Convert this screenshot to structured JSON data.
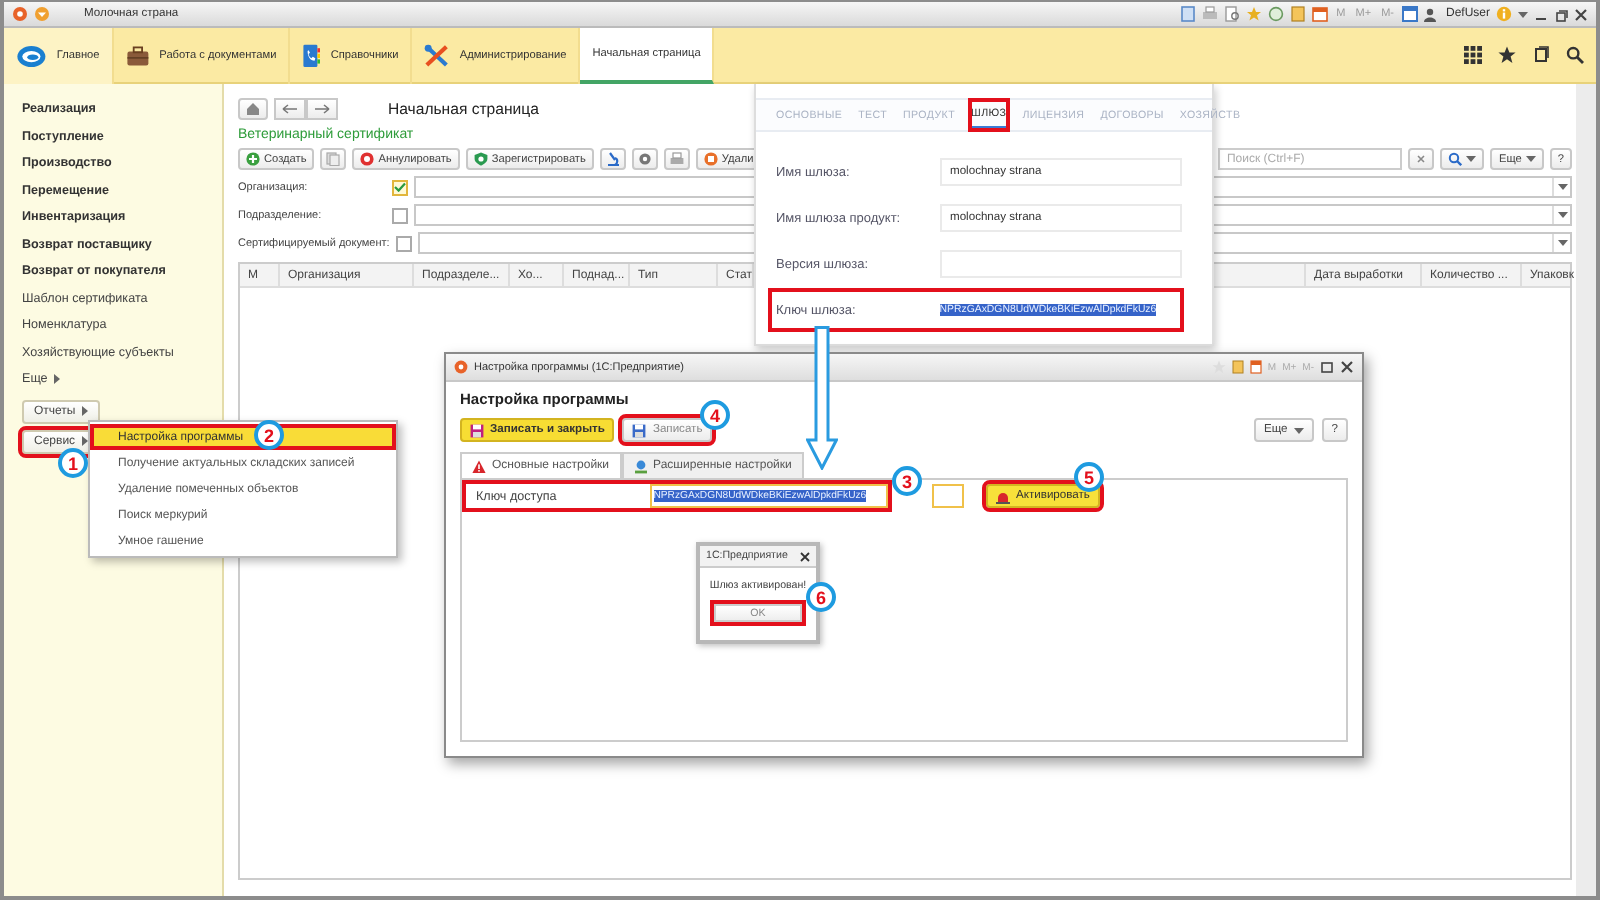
{
  "window": {
    "title": "Молочная страна",
    "memory_buttons": [
      "M",
      "M+",
      "M-"
    ],
    "user": "DefUser"
  },
  "sections": [
    {
      "label": "Главное",
      "selected": false
    },
    {
      "label": "Работа с документами",
      "selected": false
    },
    {
      "label": "Справочники",
      "selected": false
    },
    {
      "label": "Администрирование",
      "selected": false
    },
    {
      "label": "Начальная страница",
      "selected": true
    }
  ],
  "sidebar": {
    "items": [
      {
        "label": "Реализация",
        "kind": "bold"
      },
      {
        "label": "Поступление",
        "kind": "bold"
      },
      {
        "label": "Производство",
        "kind": "bold"
      },
      {
        "label": "Перемещение",
        "kind": "bold"
      },
      {
        "label": "Инвентаризация",
        "kind": "bold"
      },
      {
        "label": "Возврат поставщику",
        "kind": "bold"
      },
      {
        "label": "Возврат от покупателя",
        "kind": "bold"
      },
      {
        "label": "Шаблон сертификата",
        "kind": "plain"
      },
      {
        "label": "Номенклатура",
        "kind": "plain"
      },
      {
        "label": "Хозяйствующие субъекты",
        "kind": "plain"
      },
      {
        "label": "Еще",
        "kind": "more"
      }
    ],
    "buttons": [
      {
        "label": "Отчеты",
        "framed": false
      },
      {
        "label": "Сервис",
        "framed": true
      }
    ]
  },
  "service_menu": {
    "items": [
      {
        "label": "Настройка программы",
        "selected": true,
        "framed": true
      },
      {
        "label": "Получение актуальных складских записей",
        "selected": false,
        "framed": false
      },
      {
        "label": "Удаление помеченных объектов",
        "selected": false,
        "framed": false
      },
      {
        "label": "Поиск меркурий",
        "selected": false,
        "framed": false
      },
      {
        "label": "Умное гашение",
        "selected": false,
        "framed": false
      }
    ]
  },
  "form": {
    "title": "Начальная страница",
    "list_title": "Ветеринарный сертификат",
    "toolbar": [
      "Создать",
      "Аннулировать",
      "Зарегистрировать",
      "Удали"
    ],
    "search": {
      "placeholder": "Поиск (Ctrl+F)"
    },
    "more": "Еще",
    "help": "?",
    "filters": [
      {
        "label": "Организация:",
        "checked": true
      },
      {
        "label": "Подразделение:",
        "checked": false
      },
      {
        "label": "Сертифицируемый документ:",
        "checked": false
      }
    ],
    "table": {
      "columns": [
        "М",
        "Организация",
        "Подразделе...",
        "Хо...",
        "Поднад...",
        "Тип",
        "Стат",
        "Дата выработки",
        "Количество ...",
        "Упаковк"
      ]
    }
  },
  "gateway_panel": {
    "tabs": [
      {
        "label": "ОСНОВНЫЕ",
        "selected": false,
        "framed": false
      },
      {
        "label": "ТЕСТ",
        "selected": false,
        "framed": false
      },
      {
        "label": "ПРОДУКТ",
        "selected": false,
        "framed": false
      },
      {
        "label": "ШЛЮЗ",
        "selected": true,
        "framed": true
      },
      {
        "label": "ЛИЦЕНЗИЯ",
        "selected": false,
        "framed": false
      },
      {
        "label": "ДОГОВОРЫ",
        "selected": false,
        "framed": false
      },
      {
        "label": "ХОЗЯЙСТВ",
        "selected": false,
        "framed": false
      }
    ],
    "fields": [
      {
        "label": "Имя шлюза:",
        "value": "molochnay strana",
        "framed": false
      },
      {
        "label": "Имя шлюза продукт:",
        "value": "molochnay strana",
        "framed": false
      },
      {
        "label": "Версия шлюза:",
        "framed": false
      },
      {
        "label": "Ключ шлюза:",
        "value": "NPRzGAxDGN8UdWDkeBKiEzwAlDpkdFkUz6",
        "framed": true
      }
    ]
  },
  "settings_dialog": {
    "window_title": "Настройка программы (1С:Предприятие)",
    "memory_buttons": [
      "M",
      "M+",
      "M-"
    ],
    "title": "Настройка программы",
    "buttons": [
      {
        "label": "Записать и закрыть",
        "kind": "primary",
        "framed": false
      },
      {
        "label": "Записать",
        "kind": "normal",
        "framed": true
      }
    ],
    "more": "Еще",
    "help": "?",
    "tabs": [
      {
        "label": "Основные настройки",
        "selected": true
      },
      {
        "label": "Расширенные настройки",
        "selected": false
      }
    ],
    "key_field": {
      "label": "Ключ доступа",
      "value": "NPRzGAxDGN8UdWDkeBKiEzwAlDpkdFkUz6",
      "framed": true
    },
    "activate": {
      "label": "Активировать",
      "framed": true
    }
  },
  "message_box": {
    "title": "1С:Предприятие",
    "text": "Шлюз активирован!",
    "button": "OK",
    "framed": true
  },
  "steps": [
    "1",
    "2",
    "3",
    "4",
    "5",
    "6"
  ]
}
